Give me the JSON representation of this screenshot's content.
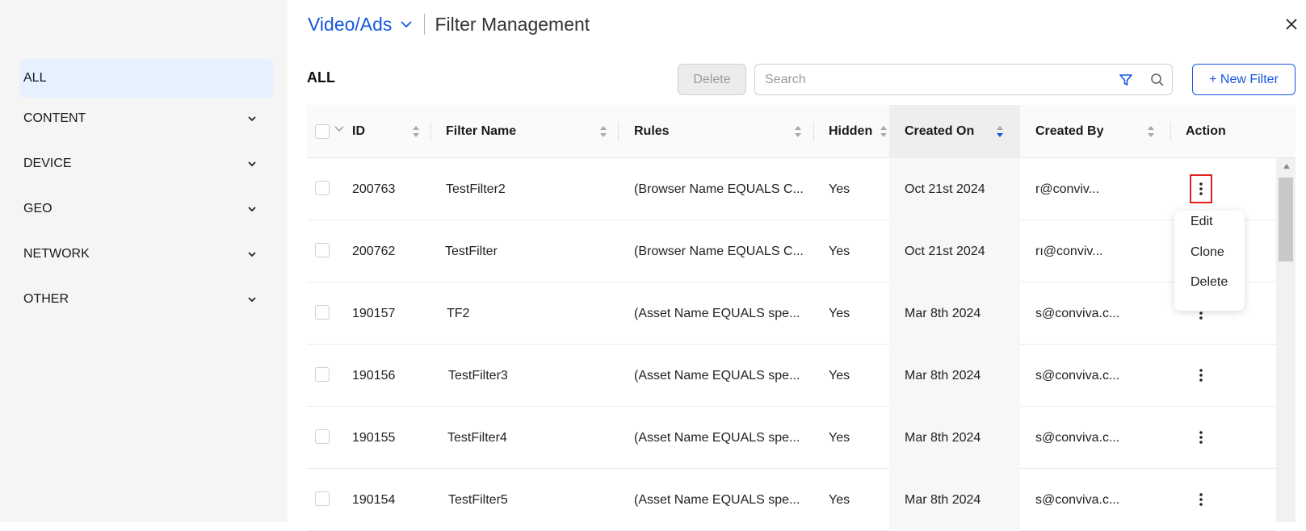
{
  "sidebar": {
    "items": [
      {
        "label": "ALL",
        "active": true,
        "expandable": false
      },
      {
        "label": "CONTENT",
        "active": false,
        "expandable": true
      },
      {
        "label": "DEVICE",
        "active": false,
        "expandable": true
      },
      {
        "label": "GEO",
        "active": false,
        "expandable": true
      },
      {
        "label": "NETWORK",
        "active": false,
        "expandable": true
      },
      {
        "label": "OTHER",
        "active": false,
        "expandable": true
      }
    ]
  },
  "header": {
    "app_label": "Video/Ads",
    "title": "Filter Management"
  },
  "toolbar": {
    "section_title": "ALL",
    "delete_label": "Delete",
    "search_placeholder": "Search",
    "new_filter_label": "+ New Filter"
  },
  "table": {
    "columns": [
      "ID",
      "Filter Name",
      "Rules",
      "Hidden",
      "Created On",
      "Created By",
      "Action"
    ],
    "sorted_column": "Created On",
    "rows": [
      {
        "id": "200763",
        "name": "TestFilter2",
        "rules": "(Browser Name EQUALS C...",
        "hidden": "Yes",
        "created_on": "Oct 21st 2024",
        "created_by": "r@conviv..."
      },
      {
        "id": "200762",
        "name": "TestFilter",
        "rules": "(Browser Name EQUALS C...",
        "hidden": "Yes",
        "created_on": "Oct 21st 2024",
        "created_by": "rı@conviv..."
      },
      {
        "id": "190157",
        "name": "TF2",
        "rules": "(Asset Name EQUALS spe...",
        "hidden": "Yes",
        "created_on": "Mar 8th 2024",
        "created_by": "s@conviva.c..."
      },
      {
        "id": "190156",
        "name": "TestFilter3",
        "rules": "(Asset Name EQUALS spe...",
        "hidden": "Yes",
        "created_on": "Mar 8th 2024",
        "created_by": "s@conviva.c..."
      },
      {
        "id": "190155",
        "name": "TestFilter4",
        "rules": "(Asset Name EQUALS spe...",
        "hidden": "Yes",
        "created_on": "Mar 8th 2024",
        "created_by": "s@conviva.c..."
      },
      {
        "id": "190154",
        "name": "TestFilter5",
        "rules": "(Asset Name EQUALS spe...",
        "hidden": "Yes",
        "created_on": "Mar 8th 2024",
        "created_by": "s@conviva.c..."
      }
    ]
  },
  "action_menu": {
    "items": [
      "Edit",
      "Clone",
      "Delete"
    ]
  },
  "colors": {
    "accent": "#1656e0",
    "highlight": "#e02020",
    "sidebar_active": "#e6f0ff"
  },
  "icons": [
    "chevron-down-icon",
    "close-icon",
    "filter-funnel-icon",
    "search-icon",
    "sort-icon",
    "kebab-menu-icon",
    "scroll-up-arrow-icon"
  ]
}
